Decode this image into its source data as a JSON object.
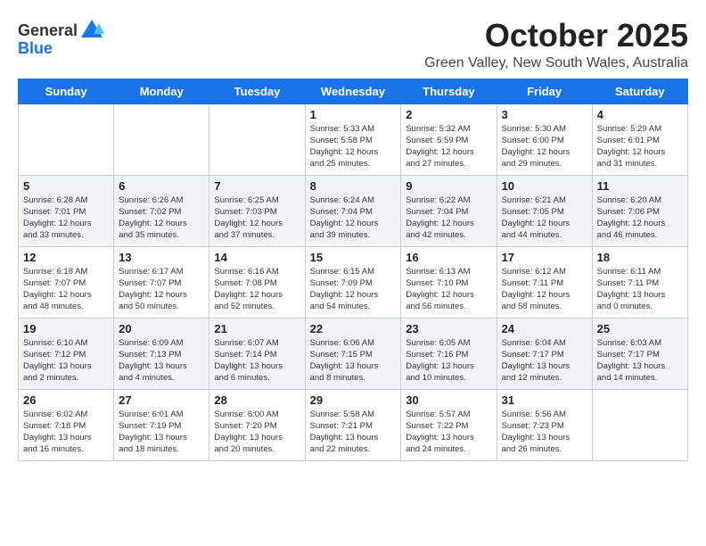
{
  "logo": {
    "general": "General",
    "blue": "Blue"
  },
  "header": {
    "month": "October 2025",
    "location": "Green Valley, New South Wales, Australia"
  },
  "weekdays": [
    "Sunday",
    "Monday",
    "Tuesday",
    "Wednesday",
    "Thursday",
    "Friday",
    "Saturday"
  ],
  "weeks": [
    [
      {
        "day": "",
        "info": ""
      },
      {
        "day": "",
        "info": ""
      },
      {
        "day": "",
        "info": ""
      },
      {
        "day": "1",
        "info": "Sunrise: 5:33 AM\nSunset: 5:58 PM\nDaylight: 12 hours\nand 25 minutes."
      },
      {
        "day": "2",
        "info": "Sunrise: 5:32 AM\nSunset: 5:59 PM\nDaylight: 12 hours\nand 27 minutes."
      },
      {
        "day": "3",
        "info": "Sunrise: 5:30 AM\nSunset: 6:00 PM\nDaylight: 12 hours\nand 29 minutes."
      },
      {
        "day": "4",
        "info": "Sunrise: 5:29 AM\nSunset: 6:01 PM\nDaylight: 12 hours\nand 31 minutes."
      }
    ],
    [
      {
        "day": "5",
        "info": "Sunrise: 6:28 AM\nSunset: 7:01 PM\nDaylight: 12 hours\nand 33 minutes."
      },
      {
        "day": "6",
        "info": "Sunrise: 6:26 AM\nSunset: 7:02 PM\nDaylight: 12 hours\nand 35 minutes."
      },
      {
        "day": "7",
        "info": "Sunrise: 6:25 AM\nSunset: 7:03 PM\nDaylight: 12 hours\nand 37 minutes."
      },
      {
        "day": "8",
        "info": "Sunrise: 6:24 AM\nSunset: 7:04 PM\nDaylight: 12 hours\nand 39 minutes."
      },
      {
        "day": "9",
        "info": "Sunrise: 6:22 AM\nSunset: 7:04 PM\nDaylight: 12 hours\nand 42 minutes."
      },
      {
        "day": "10",
        "info": "Sunrise: 6:21 AM\nSunset: 7:05 PM\nDaylight: 12 hours\nand 44 minutes."
      },
      {
        "day": "11",
        "info": "Sunrise: 6:20 AM\nSunset: 7:06 PM\nDaylight: 12 hours\nand 46 minutes."
      }
    ],
    [
      {
        "day": "12",
        "info": "Sunrise: 6:18 AM\nSunset: 7:07 PM\nDaylight: 12 hours\nand 48 minutes."
      },
      {
        "day": "13",
        "info": "Sunrise: 6:17 AM\nSunset: 7:07 PM\nDaylight: 12 hours\nand 50 minutes."
      },
      {
        "day": "14",
        "info": "Sunrise: 6:16 AM\nSunset: 7:08 PM\nDaylight: 12 hours\nand 52 minutes."
      },
      {
        "day": "15",
        "info": "Sunrise: 6:15 AM\nSunset: 7:09 PM\nDaylight: 12 hours\nand 54 minutes."
      },
      {
        "day": "16",
        "info": "Sunrise: 6:13 AM\nSunset: 7:10 PM\nDaylight: 12 hours\nand 56 minutes."
      },
      {
        "day": "17",
        "info": "Sunrise: 6:12 AM\nSunset: 7:11 PM\nDaylight: 12 hours\nand 58 minutes."
      },
      {
        "day": "18",
        "info": "Sunrise: 6:11 AM\nSunset: 7:11 PM\nDaylight: 13 hours\nand 0 minutes."
      }
    ],
    [
      {
        "day": "19",
        "info": "Sunrise: 6:10 AM\nSunset: 7:12 PM\nDaylight: 13 hours\nand 2 minutes."
      },
      {
        "day": "20",
        "info": "Sunrise: 6:09 AM\nSunset: 7:13 PM\nDaylight: 13 hours\nand 4 minutes."
      },
      {
        "day": "21",
        "info": "Sunrise: 6:07 AM\nSunset: 7:14 PM\nDaylight: 13 hours\nand 6 minutes."
      },
      {
        "day": "22",
        "info": "Sunrise: 6:06 AM\nSunset: 7:15 PM\nDaylight: 13 hours\nand 8 minutes."
      },
      {
        "day": "23",
        "info": "Sunrise: 6:05 AM\nSunset: 7:16 PM\nDaylight: 13 hours\nand 10 minutes."
      },
      {
        "day": "24",
        "info": "Sunrise: 6:04 AM\nSunset: 7:17 PM\nDaylight: 13 hours\nand 12 minutes."
      },
      {
        "day": "25",
        "info": "Sunrise: 6:03 AM\nSunset: 7:17 PM\nDaylight: 13 hours\nand 14 minutes."
      }
    ],
    [
      {
        "day": "26",
        "info": "Sunrise: 6:02 AM\nSunset: 7:18 PM\nDaylight: 13 hours\nand 16 minutes."
      },
      {
        "day": "27",
        "info": "Sunrise: 6:01 AM\nSunset: 7:19 PM\nDaylight: 13 hours\nand 18 minutes."
      },
      {
        "day": "28",
        "info": "Sunrise: 6:00 AM\nSunset: 7:20 PM\nDaylight: 13 hours\nand 20 minutes."
      },
      {
        "day": "29",
        "info": "Sunrise: 5:58 AM\nSunset: 7:21 PM\nDaylight: 13 hours\nand 22 minutes."
      },
      {
        "day": "30",
        "info": "Sunrise: 5:57 AM\nSunset: 7:22 PM\nDaylight: 13 hours\nand 24 minutes."
      },
      {
        "day": "31",
        "info": "Sunrise: 5:56 AM\nSunset: 7:23 PM\nDaylight: 13 hours\nand 26 minutes."
      },
      {
        "day": "",
        "info": ""
      }
    ]
  ]
}
